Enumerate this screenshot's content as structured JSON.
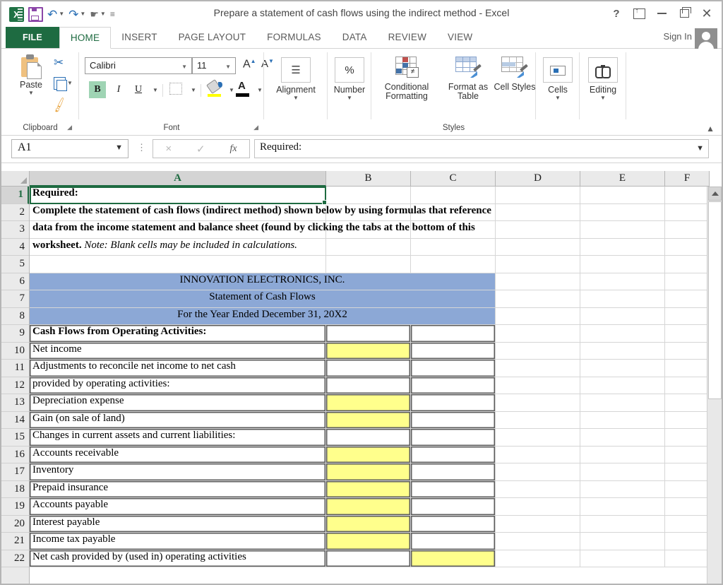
{
  "window": {
    "title": "Prepare a statement of cash flows using the indirect method - Excel",
    "help_label": "?",
    "ribbon_display_label": "Ribbon Display Options",
    "minimize_label": "Minimize",
    "restore_label": "Restore Down",
    "close_label": "Close"
  },
  "quick_access": {
    "app_icon": "excel-icon",
    "items": [
      {
        "name": "save-icon",
        "label": "Save"
      },
      {
        "name": "undo-icon",
        "label": "Undo"
      },
      {
        "name": "redo-icon",
        "label": "Redo"
      },
      {
        "name": "touch-mode-icon",
        "label": "Touch/Mouse Mode"
      },
      {
        "name": "customize-qat-icon",
        "label": "Customize Quick Access Toolbar"
      }
    ]
  },
  "tabs": {
    "file": "FILE",
    "items": [
      "HOME",
      "INSERT",
      "PAGE LAYOUT",
      "FORMULAS",
      "DATA",
      "REVIEW",
      "VIEW"
    ],
    "active": "HOME",
    "sign_in": "Sign In"
  },
  "ribbon": {
    "groups": [
      {
        "label": "Clipboard"
      },
      {
        "label": "Font"
      },
      {
        "label": "Styles"
      }
    ],
    "clipboard": {
      "paste_label": "Paste",
      "cut_label": "Cut",
      "copy_label": "Copy",
      "format_painter_label": "Format Painter",
      "group_label": "Clipboard"
    },
    "font": {
      "font_name": "Calibri",
      "font_size": "11",
      "bold": "B",
      "italic": "I",
      "underline": "U",
      "group_label": "Font"
    },
    "alignment": {
      "label": "Alignment"
    },
    "number": {
      "label": "Number"
    },
    "styles": {
      "conditional_formatting": "Conditional Formatting",
      "format_as_table": "Format as Table",
      "cell_styles": "Cell Styles",
      "group_label": "Styles"
    },
    "cells": {
      "label": "Cells"
    },
    "editing": {
      "label": "Editing"
    },
    "collapse_label": "Collapse the Ribbon"
  },
  "formula_bar": {
    "name_box": "A1",
    "cancel": "×",
    "enter": "✓",
    "insert_function": "fx",
    "content": "Required:"
  },
  "grid": {
    "columns": [
      "A",
      "B",
      "C",
      "D",
      "E",
      "F"
    ],
    "selected_column": "A",
    "selected_row": 1,
    "rows": [
      {
        "n": 1,
        "a": "Required:",
        "bold": true
      },
      {
        "n": 2,
        "a": "Complete the statement of cash flows (indirect method) shown below by using formulas that reference",
        "bold": true,
        "wide": true
      },
      {
        "n": 3,
        "a": "data from the income statement and balance sheet (found by clicking the tabs at the bottom of this",
        "bold": true,
        "wide": true
      },
      {
        "n": 4,
        "a": "worksheet.",
        "a2": "Note: Blank cells may be included in calculations.",
        "bold": true,
        "wide": true
      },
      {
        "n": 5,
        "a": ""
      },
      {
        "n": 6,
        "a": "INNOVATION ELECTRONICS, INC.",
        "merged": true,
        "fill": "blue",
        "center": true
      },
      {
        "n": 7,
        "a": "Statement of Cash Flows",
        "merged": true,
        "fill": "blue",
        "center": true
      },
      {
        "n": 8,
        "a": "For the Year Ended December 31, 20X2",
        "merged": true,
        "fill": "blue",
        "center": true
      },
      {
        "n": 9,
        "a": "Cash Flows from Operating Activities:",
        "bold": true,
        "boxed": true
      },
      {
        "n": 10,
        "a": "Net income",
        "b_fill": "yellow",
        "boxed": true
      },
      {
        "n": 11,
        "a": "Adjustments to reconcile net income to net cash",
        "boxed": true
      },
      {
        "n": 12,
        "a": "provided by operating activities:",
        "boxed": true
      },
      {
        "n": 13,
        "a": "Depreciation expense",
        "b_fill": "yellow",
        "boxed": true
      },
      {
        "n": 14,
        "a": "Gain (on sale of land)",
        "b_fill": "yellow",
        "boxed": true
      },
      {
        "n": 15,
        "a": "Changes in current assets and current liabilities:",
        "boxed": true
      },
      {
        "n": 16,
        "a": "Accounts receivable",
        "b_fill": "yellow",
        "boxed": true
      },
      {
        "n": 17,
        "a": "Inventory",
        "b_fill": "yellow",
        "boxed": true
      },
      {
        "n": 18,
        "a": "Prepaid insurance",
        "b_fill": "yellow",
        "boxed": true
      },
      {
        "n": 19,
        "a": "Accounts payable",
        "b_fill": "yellow",
        "boxed": true
      },
      {
        "n": 20,
        "a": "Interest payable",
        "b_fill": "yellow",
        "boxed": true
      },
      {
        "n": 21,
        "a": "Income tax payable",
        "b_fill": "yellow",
        "boxed": true
      },
      {
        "n": 22,
        "a": "Net cash provided by (used in) operating activities",
        "c_fill": "yellow",
        "boxed": true
      }
    ]
  },
  "colors": {
    "header_fill": "#8ca8d6",
    "input_fill": "#ffff8c",
    "excel_green": "#1e6b41",
    "selection_green": "#1e6b41"
  }
}
